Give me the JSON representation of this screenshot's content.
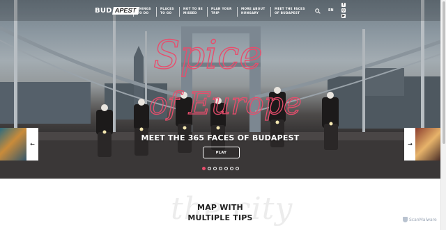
{
  "header": {
    "logo_text": "BUD",
    "logo_flag": "APEST",
    "nav": [
      {
        "line1": "THINGS",
        "line2": "TO DO"
      },
      {
        "line1": "PLACES",
        "line2": "TO GO"
      },
      {
        "line1": "NOT TO BE",
        "line2": "MISSED"
      },
      {
        "line1": "PLAN YOUR",
        "line2": "TRIP"
      },
      {
        "line1": "MORE ABOUT",
        "line2": "HUNGARY"
      },
      {
        "line1": "MEET THE FACES",
        "line2": "OF BUDAPEST"
      }
    ],
    "lang": "EN",
    "social_icons": [
      "facebook-icon",
      "instagram-icon",
      "youtube-icon"
    ]
  },
  "hero": {
    "script_line1": "Spice",
    "script_line2": "of Europe",
    "caption": "MEET THE 365 FACES OF BUDAPEST",
    "play_label": "PLAY",
    "dots_total": 7,
    "dots_active_index": 0,
    "prev_arrow": "←",
    "next_arrow": "→",
    "accent_color": "#e84d6c"
  },
  "section": {
    "watermark": "the city",
    "title_line1": "MAP WITH",
    "title_line2": "MULTIPLE TIPS"
  },
  "badge": {
    "label": "ScanMalware"
  }
}
